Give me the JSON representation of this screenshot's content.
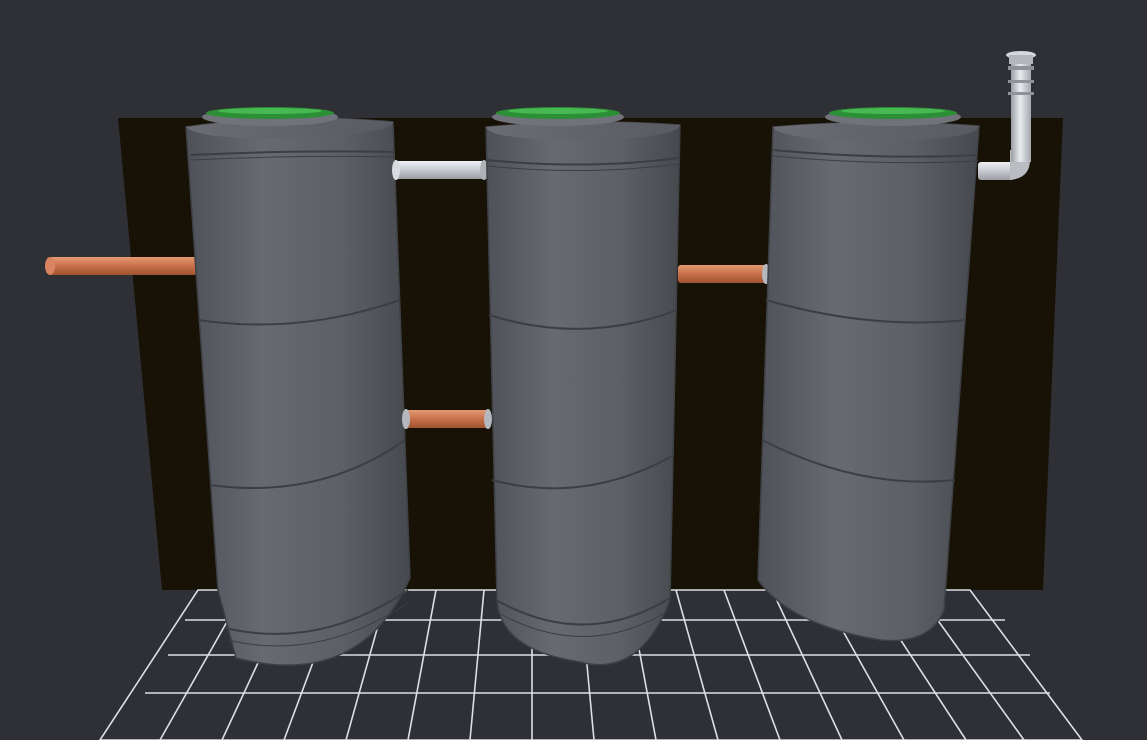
{
  "scene": {
    "background_color": "#2f3036",
    "backdrop_color": "#181105",
    "grid_color": "#dcdfe6",
    "tank_body_color": "#5e6167",
    "tank_lid_color": "#2a8f35",
    "pipe_orange_color": "#c8704a",
    "pipe_gray_color": "#c7cbd0",
    "tank_count": 3,
    "segments_per_tank": 3
  }
}
